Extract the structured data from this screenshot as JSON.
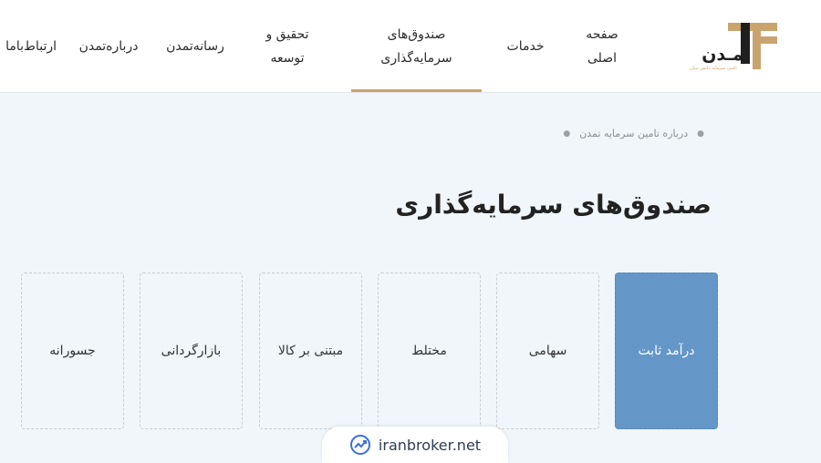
{
  "header": {
    "logo_text": "تمـدن",
    "logo_subtext": "تامین سرمایه دانش بنیان",
    "nav": [
      {
        "line1": "صفحه",
        "line2": "اصلی"
      },
      {
        "line1": "خدمات",
        "line2": ""
      },
      {
        "line1": "صندوق‌های",
        "line2": "سرمایه‌گذاری"
      },
      {
        "line1": "تحقیق و",
        "line2": "توسعه"
      },
      {
        "line1": "رسانه‌تمدن",
        "line2": ""
      },
      {
        "line1": "درباره‌تمدن",
        "line2": ""
      },
      {
        "line1": "ارتباط‌باما",
        "line2": ""
      }
    ],
    "colors": {
      "accent": "#c9a46e",
      "logo_dark": "#1f1f1f"
    }
  },
  "breadcrumb": {
    "items": [
      "درباره تامین سرمایه تمدن"
    ]
  },
  "page_title": "صندوق‌های سرمایه‌گذاری",
  "fund_cards": [
    {
      "label": "درآمد ثابت",
      "active": true
    },
    {
      "label": "سهامی",
      "active": false
    },
    {
      "label": "مختلط",
      "active": false
    },
    {
      "label": "مبتنی بر کالا",
      "active": false
    },
    {
      "label": "بازارگردانی",
      "active": false
    },
    {
      "label": "جسورانه",
      "active": false
    }
  ],
  "watermark": {
    "text": "iranbroker.net",
    "icon": "chart-trend-icon"
  },
  "colors": {
    "card_active": "#6496c8",
    "background": "#f0f6fa"
  }
}
